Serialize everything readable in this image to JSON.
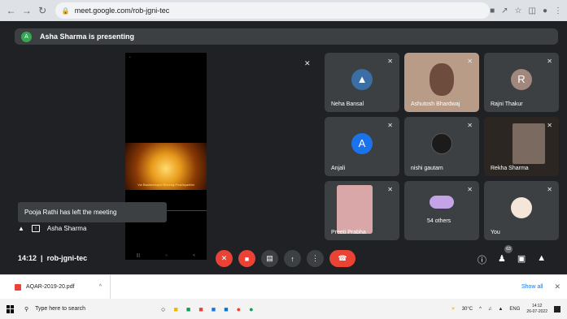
{
  "browser": {
    "url": "meet.google.com/rob-jgni-tec"
  },
  "presenting_banner": {
    "avatar_letter": "A",
    "text": "Asha Sharma is presenting"
  },
  "shared_screen": {
    "caption": "Vw Basheeduput Bheeraj Pnadhyadhhi"
  },
  "tiles": [
    {
      "name": "Neha Bansal",
      "avatar_type": "photo",
      "color": "#3b6ea5"
    },
    {
      "name": "Ashutosh Bhardwaj",
      "avatar_type": "video",
      "color": "#b89c88"
    },
    {
      "name": "Rajni Thakur",
      "avatar_type": "letter",
      "letter": "R",
      "color": "#a1887f"
    },
    {
      "name": "Anjali",
      "avatar_type": "letter",
      "letter": "A",
      "color": "#1a73e8"
    },
    {
      "name": "nishi gautam",
      "avatar_type": "photo",
      "color": "#1b1b1b"
    },
    {
      "name": "Rekha Sharma",
      "avatar_type": "video",
      "color": "#7a6a5f"
    },
    {
      "name": "Preeti Prabha",
      "avatar_type": "video",
      "color": "#d9a7a7"
    },
    {
      "name": "54 others",
      "avatar_type": "group",
      "color": "#c4a3e8"
    },
    {
      "name": "You",
      "avatar_type": "photo",
      "color": "#f4e6d8"
    }
  ],
  "toast": {
    "text": "Pooja Rathi has left the meeting"
  },
  "presenter_label": {
    "name": "Asha Sharma"
  },
  "bottombar": {
    "time": "14:12",
    "meeting_code": "rob-jgni-tec",
    "participant_count": "63"
  },
  "downloads": {
    "file": "AQAR-2019-20.pdf",
    "show_all": "Show all"
  },
  "taskbar": {
    "search_placeholder": "Type here to search",
    "weather": "30°C",
    "lang": "ENG",
    "time": "14:12",
    "date": "26-07-2022"
  },
  "colors": {
    "accent_red": "#ea4335",
    "meet_bg": "#202124",
    "tile_bg": "#3c4043"
  }
}
